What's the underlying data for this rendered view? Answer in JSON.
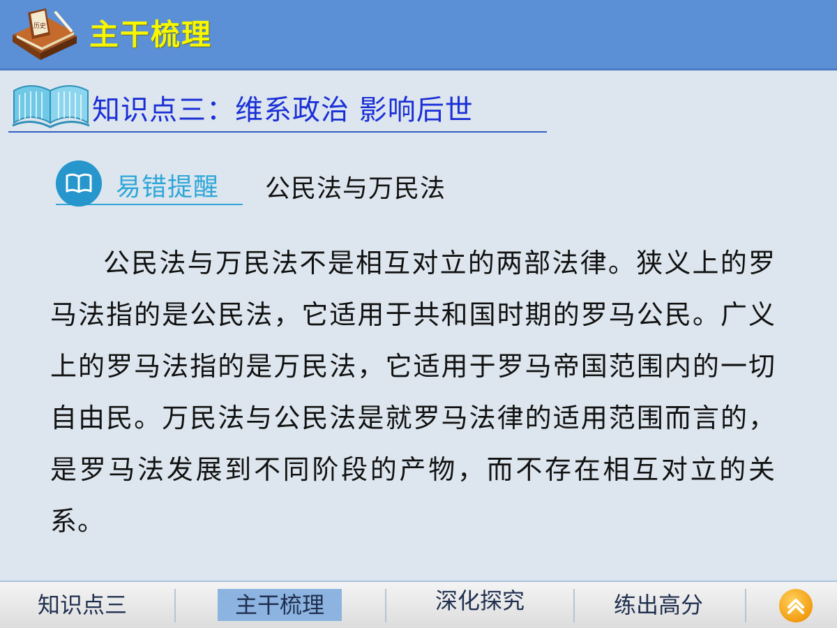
{
  "header": {
    "title": "主干梳理",
    "logo_icon": "history-book-icon",
    "logo_book_text": "历史"
  },
  "section": {
    "title": "知识点三：维系政治 影响后世",
    "icon": "open-book-icon"
  },
  "tip": {
    "icon": "book-circle-icon",
    "label": "易错提醒",
    "topic": "公民法与万民法"
  },
  "body": {
    "paragraph": "公民法与万民法不是相互对立的两部法律。狭义上的罗马法指的是公民法，它适用于共和国时期的罗马公民。广义上的罗马法指的是万民法，它适用于罗马帝国范围内的一切自由民。万民法与公民法是就罗马法律的适用范围而言的，是罗马法发展到不同阶段的产物，而不存在相互对立的关系。"
  },
  "nav": {
    "items": [
      {
        "label": "知识点三",
        "active": false
      },
      {
        "label": "主干梳理",
        "active": true
      },
      {
        "label": "深化探究",
        "active": false
      },
      {
        "label": "练出高分",
        "active": false
      }
    ],
    "home_icon": "chevron-up-home-icon"
  },
  "colors": {
    "header_bg": "#5b8fd6",
    "header_title": "#f7f700",
    "section_title": "#1a2fd6",
    "tip_accent": "#2ea6d8",
    "page_bg": "#dde6ee",
    "nav_active": "#8db4e0",
    "home_button": "#f29d12"
  }
}
